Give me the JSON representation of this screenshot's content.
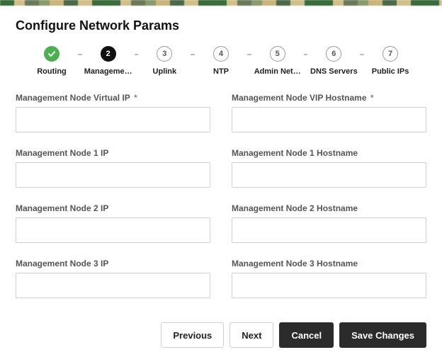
{
  "title": "Configure Network Params",
  "stepper": [
    {
      "label": "Routing",
      "state": "done",
      "num": "✓"
    },
    {
      "label": "Manageme…",
      "state": "active",
      "num": "2"
    },
    {
      "label": "Uplink",
      "state": "pending",
      "num": "3"
    },
    {
      "label": "NTP",
      "state": "pending",
      "num": "4"
    },
    {
      "label": "Admin Net…",
      "state": "pending",
      "num": "5"
    },
    {
      "label": "DNS Servers",
      "state": "pending",
      "num": "6"
    },
    {
      "label": "Public IPs",
      "state": "pending",
      "num": "7"
    }
  ],
  "fields": {
    "vip_ip": {
      "label": "Management Node Virtual IP",
      "required": true,
      "value": ""
    },
    "vip_host": {
      "label": "Management Node VIP Hostname",
      "required": true,
      "value": ""
    },
    "n1_ip": {
      "label": "Management Node 1 IP",
      "required": false,
      "value": ""
    },
    "n1_host": {
      "label": "Management Node 1 Hostname",
      "required": false,
      "value": ""
    },
    "n2_ip": {
      "label": "Management Node 2 IP",
      "required": false,
      "value": ""
    },
    "n2_host": {
      "label": "Management Node 2 Hostname",
      "required": false,
      "value": ""
    },
    "n3_ip": {
      "label": "Management Node 3 IP",
      "required": false,
      "value": ""
    },
    "n3_host": {
      "label": "Management Node 3 Hostname",
      "required": false,
      "value": ""
    }
  },
  "buttons": {
    "previous": "Previous",
    "next": "Next",
    "cancel": "Cancel",
    "save": "Save Changes"
  },
  "required_marker": "*"
}
